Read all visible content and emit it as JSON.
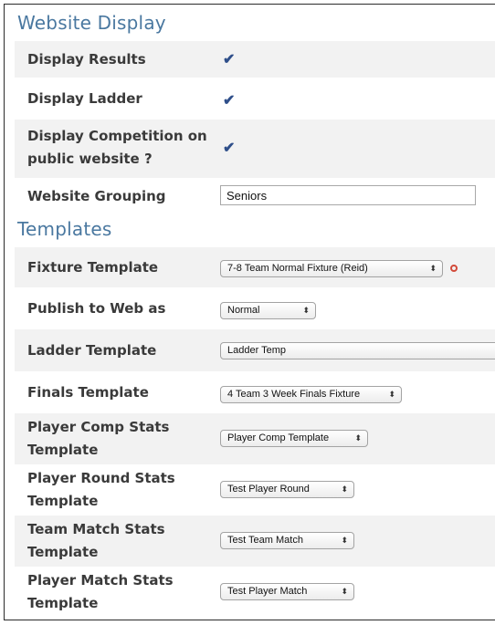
{
  "website_display": {
    "title": "Website Display",
    "display_results_label": "Display Results",
    "display_ladder_label": "Display Ladder",
    "display_competition_label_line1": "Display Competition on",
    "display_competition_label_line2": "public website ?",
    "website_grouping_label": "Website Grouping",
    "website_grouping_value": "Seniors",
    "check_glyph": "✔"
  },
  "templates": {
    "title": "Templates",
    "fixture_label": "Fixture Template",
    "fixture_value": "7-8 Team Normal Fixture (Reid)",
    "publish_label": "Publish to Web as",
    "publish_value": "Normal",
    "ladder_label": "Ladder Template",
    "ladder_value": "Ladder Temp",
    "finals_label": "Finals Template",
    "finals_value": "4 Team 3 Week Finals Fixture",
    "player_comp_label_line1": "Player Comp Stats",
    "player_comp_label_line2": "Template",
    "player_comp_value": "Player Comp Template",
    "player_round_label_line1": "Player Round Stats",
    "player_round_label_line2": "Template",
    "player_round_value": "Test Player Round",
    "team_match_label_line1": "Team Match Stats",
    "team_match_label_line2": "Template",
    "team_match_value": "Test Team Match",
    "player_match_label_line1": "Player Match Stats",
    "player_match_label_line2": "Template",
    "player_match_value": "Test Player Match",
    "select_arrow": "⬍"
  },
  "colors": {
    "heading": "#4a78a0",
    "row_shade": "#f2f2f2",
    "required_marker": "#d24a3a"
  }
}
